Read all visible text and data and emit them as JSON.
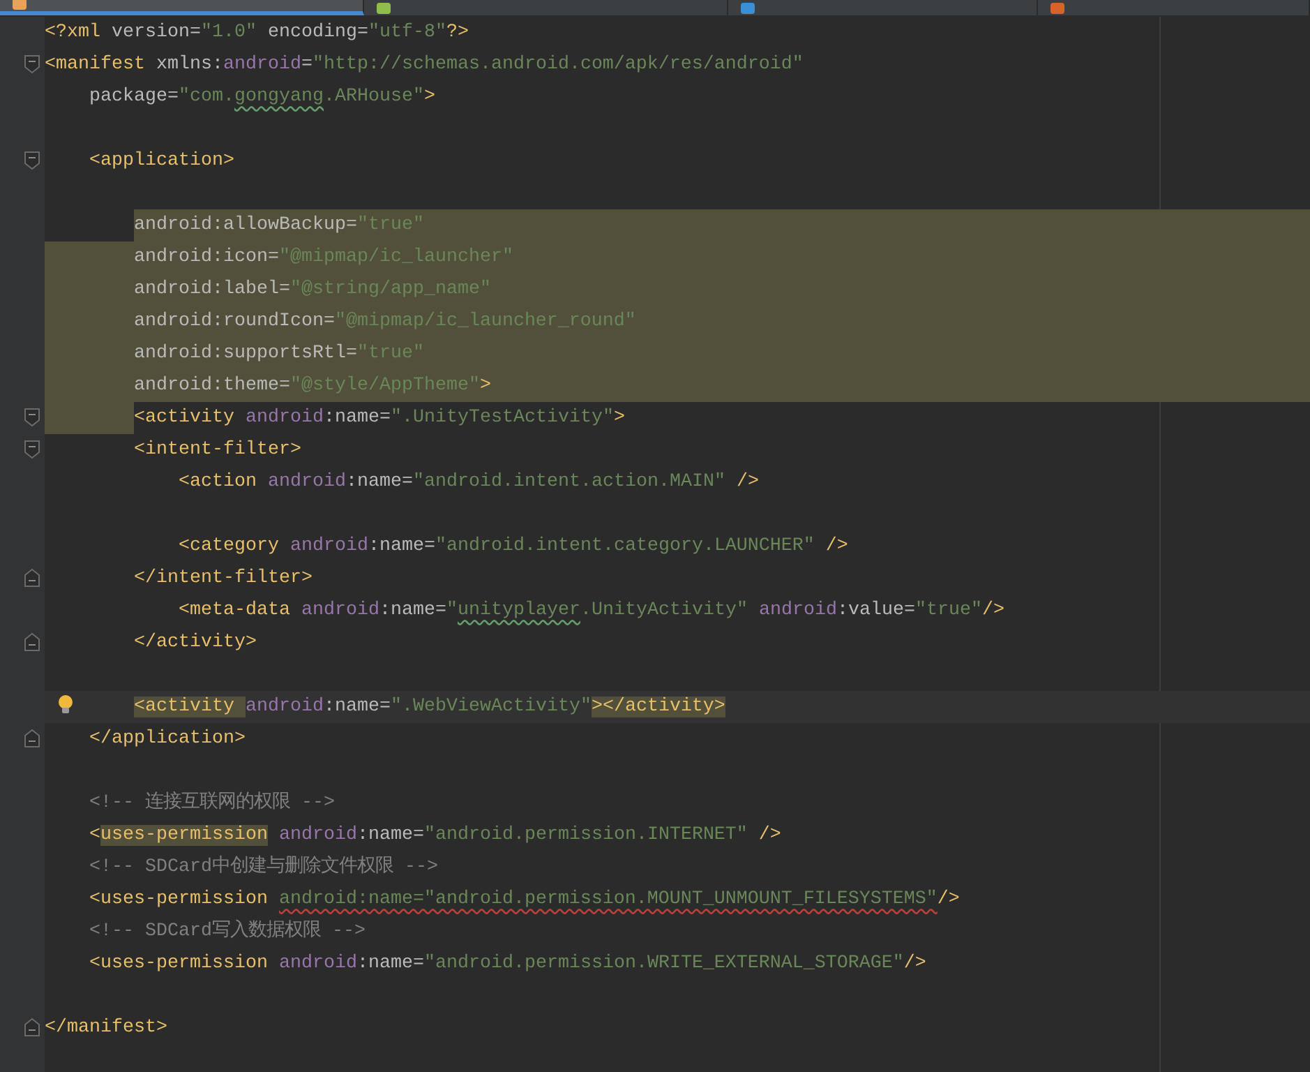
{
  "tabs": [
    {
      "kind": "xml",
      "selected": true
    },
    {
      "kind": "android",
      "selected": false
    },
    {
      "kind": "class",
      "selected": false
    },
    {
      "kind": "layout",
      "selected": false
    }
  ],
  "lines": [
    {
      "selected": false,
      "tokens": [
        {
          "text": "<?xml ",
          "kind": "text"
        },
        {
          "text": "version=",
          "kind": "attr"
        },
        {
          "text": "\"1.0\"",
          "kind": "string"
        },
        {
          "text": " encoding=",
          "kind": "attr"
        },
        {
          "text": "\"utf-8\"",
          "kind": "string"
        },
        {
          "text": "?>",
          "kind": "text"
        }
      ]
    },
    {
      "selected": false,
      "fold_start": true,
      "tokens": [
        {
          "text": "<manifest ",
          "kind": "tag"
        },
        {
          "text": "xmlns:",
          "kind": "attr"
        },
        {
          "text": "android",
          "kind": "ns"
        },
        {
          "text": "=",
          "kind": "attr"
        },
        {
          "text": "\"http://schemas.android.com/apk/res/android\"",
          "kind": "string"
        }
      ],
      "children": [
        {
          "selected": false,
          "tokens": [
            {
              "text": "package=",
              "kind": "attr"
            },
            {
              "text": "\"com.",
              "kind": "string"
            },
            {
              "text": "gongyang",
              "kind": "string",
              "misspelled": true
            },
            {
              "text": ".ARHouse\"",
              "kind": "string"
            },
            {
              "text": ">",
              "kind": "tag"
            }
          ]
        },
        {
          "selected": false
        },
        {
          "selected": false,
          "fold_start": true,
          "tokens": [
            {
              "text": "<application>",
              "kind": "tag"
            }
          ],
          "children": [
            {
              "selected": false
            },
            {
              "selected": true,
              "tokens": [
                {
                  "text": "android:allowBackup=",
                  "kind": "attr"
                },
                {
                  "text": "\"true\"",
                  "kind": "string"
                }
              ]
            },
            {
              "selected": true,
              "tokens": [
                {
                  "text": "android:icon=",
                  "kind": "attr"
                },
                {
                  "text": "\"@mipmap/ic_launcher\"",
                  "kind": "string"
                }
              ]
            },
            {
              "selected": true,
              "tokens": [
                {
                  "text": "android:label=",
                  "kind": "attr"
                },
                {
                  "text": "\"@string/app_name\"",
                  "kind": "string"
                }
              ]
            },
            {
              "selected": true,
              "tokens": [
                {
                  "text": "android:roundIcon=",
                  "kind": "attr"
                },
                {
                  "text": "\"@mipmap/ic_launcher_round\"",
                  "kind": "string"
                }
              ]
            },
            {
              "selected": true,
              "tokens": [
                {
                  "text": "android:supportsRtl=",
                  "kind": "attr"
                },
                {
                  "text": "\"true\"",
                  "kind": "string"
                }
              ]
            },
            {
              "selected": true,
              "tokens": [
                {
                  "text": "android:theme=",
                  "kind": "attr"
                },
                {
                  "text": "\"@style/AppTheme\"",
                  "kind": "string"
                },
                {
                  "text": ">",
                  "kind": "tag"
                }
              ]
            },
            {
              "selected": false,
              "fold_start": true,
              "tokens": [
                {
                  "text": "<activity ",
                  "kind": "tag"
                },
                {
                  "text": "android",
                  "kind": "ns"
                },
                {
                  "text": ":name=",
                  "kind": "attr"
                },
                {
                  "text": "\".UnityTestActivity\"",
                  "kind": "string"
                },
                {
                  "text": ">",
                  "kind": "tag"
                }
              ]
            },
            {
              "selected": false,
              "fold_start": true,
              "tokens": [
                {
                  "text": "<intent-filter>",
                  "kind": "tag"
                }
              ],
              "children": [
                {
                  "selected": false,
                  "tokens": [
                    {
                      "text": "<action ",
                      "kind": "tag"
                    },
                    {
                      "text": "android",
                      "kind": "ns"
                    },
                    {
                      "text": ":name=",
                      "kind": "attr"
                    },
                    {
                      "text": "\"android.intent.action.MAIN\"",
                      "kind": "string"
                    },
                    {
                      "text": " />",
                      "kind": "tag"
                    }
                  ]
                },
                {
                  "selected": false
                },
                {
                  "selected": false,
                  "tokens": [
                    {
                      "text": "<category ",
                      "kind": "tag"
                    },
                    {
                      "text": "android",
                      "kind": "ns"
                    },
                    {
                      "text": ":name=",
                      "kind": "attr"
                    },
                    {
                      "text": "\"android.intent.category.LAUNCHER\"",
                      "kind": "string"
                    },
                    {
                      "text": " />",
                      "kind": "tag"
                    }
                  ]
                }
              ]
            },
            {
              "selected": false,
              "fold_end": true,
              "tokens": [
                {
                  "text": "</intent-filter>",
                  "kind": "tag"
                }
              ],
              "children": [
                {
                  "selected": false,
                  "tokens": [
                    {
                      "text": "<meta-data ",
                      "kind": "tag"
                    },
                    {
                      "text": "android",
                      "kind": "ns"
                    },
                    {
                      "text": ":name=",
                      "kind": "attr"
                    },
                    {
                      "text": "\"",
                      "kind": "string"
                    },
                    {
                      "text": "unityplayer",
                      "kind": "string",
                      "misspelled": true
                    },
                    {
                      "text": ".UnityActivity\" ",
                      "kind": "string"
                    },
                    {
                      "text": "android",
                      "kind": "ns"
                    },
                    {
                      "text": ":value=",
                      "kind": "attr"
                    },
                    {
                      "text": "\"true\"",
                      "kind": "string"
                    },
                    {
                      "text": "/>",
                      "kind": "tag"
                    }
                  ]
                }
              ]
            },
            {
              "selected": false,
              "fold_end": true,
              "tokens": [
                {
                  "text": "</activity>",
                  "kind": "tag"
                }
              ]
            },
            {
              "selected": false
            },
            {
              "selected": false,
              "current": true,
              "bulb": true,
              "tokens": [
                {
                  "text": "<activity ",
                  "kind": "tag"
                },
                {
                  "text": "android",
                  "kind": "ns"
                },
                {
                  "text": ":name=",
                  "kind": "attr"
                },
                {
                  "text": "\".WebViewActivity\"",
                  "kind": "string"
                },
                {
                  "text": "></activity>",
                  "kind": "tag"
                }
              ]
            }
          ]
        },
        {
          "selected": false,
          "fold_end": true,
          "tokens": [
            {
              "text": "</application>",
              "kind": "tag"
            }
          ]
        },
        {
          "selected": false
        },
        {
          "selected": false,
          "tokens": [
            {
              "text": "<!-- 连接互联网的权限 -->",
              "kind": "comment"
            }
          ]
        },
        {
          "selected": false,
          "tokens": [
            {
              "text": "<",
              "kind": "tag"
            },
            {
              "text": "uses-permission",
              "kind": "tag",
              "highlighted": true
            },
            {
              "text": " android",
              "kind": "ns"
            },
            {
              "text": ":name=",
              "kind": "attr"
            },
            {
              "text": "\"android.permission.INTERNET\"",
              "kind": "string"
            },
            {
              "text": " />",
              "kind": "tag"
            }
          ]
        },
        {
          "selected": false,
          "tokens": [
            {
              "text": "<!-- SDCard中创建与删除文件权限 -->",
              "kind": "comment"
            }
          ]
        },
        {
          "selected": false,
          "tokens": [
            {
              "text": "<uses-permission ",
              "kind": "tag"
            },
            {
              "text": "android:name=\"android.permission.MOUNT_UNMOUNT_FILESYSTEMS\"",
              "kind": "string",
              "error": true
            },
            {
              "text": "/>",
              "kind": "tag"
            }
          ]
        },
        {
          "selected": false,
          "tokens": [
            {
              "text": "<!-- SDCard写入数据权限 -->",
              "kind": "comment"
            }
          ]
        },
        {
          "selected": false,
          "tokens": [
            {
              "text": "<uses-permission ",
              "kind": "tag"
            },
            {
              "text": "android",
              "kind": "ns"
            },
            {
              "text": ":name=",
              "kind": "attr"
            },
            {
              "text": "\"android.permission.WRITE_EXTERNAL_STORAGE\"",
              "kind": "string"
            },
            {
              "text": "/>",
              "kind": "tag"
            }
          ]
        },
        {
          "selected": false
        }
      ]
    },
    {
      "selected": false,
      "fold_end": true,
      "tokens": [
        {
          "text": "</manifest>",
          "kind": "tag"
        }
      ]
    }
  ]
}
